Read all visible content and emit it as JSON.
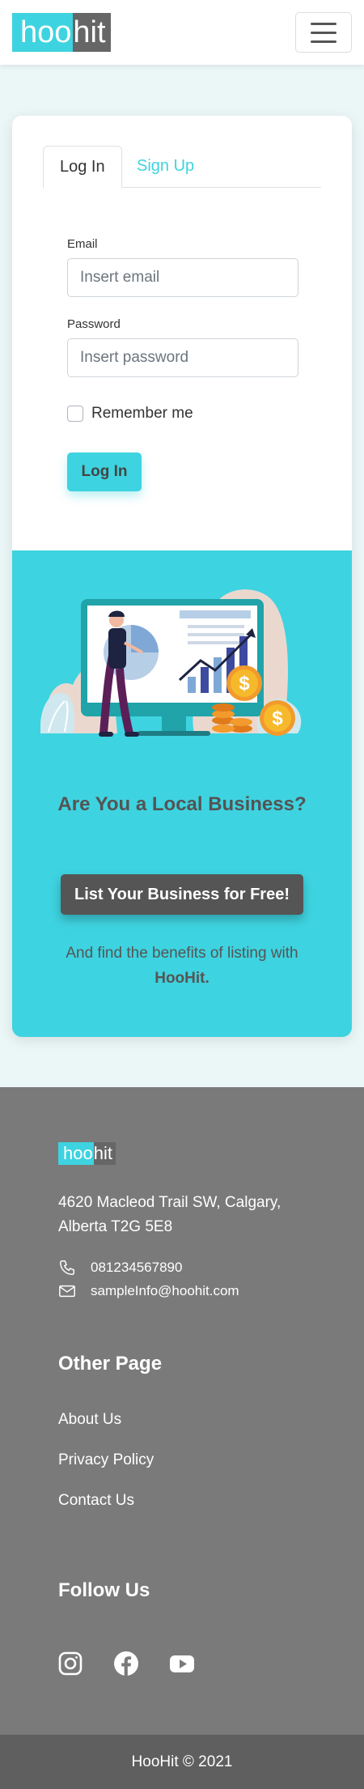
{
  "brand": {
    "part1": "hoo",
    "part2": "hit"
  },
  "tabs": {
    "login": "Log In",
    "signup": "Sign Up"
  },
  "form": {
    "email_label": "Email",
    "email_placeholder": "Insert email",
    "password_label": "Password",
    "password_placeholder": "Insert password",
    "remember_label": "Remember me",
    "submit_label": "Log In"
  },
  "promo": {
    "title": "Are You a Local Business?",
    "button": "List Your Business for Free!",
    "text": "And find the benefits of listing with",
    "text_bold": "HooHit."
  },
  "footer": {
    "address": "4620 Macleod Trail SW, Calgary, Alberta T2G 5E8",
    "phone": "081234567890",
    "email": "sampleInfo@hoohit.com",
    "other_heading": "Other Page",
    "links": [
      "About Us",
      "Privacy Policy",
      "Contact Us"
    ],
    "follow_heading": "Follow Us",
    "copyright": "HooHit © 2021"
  },
  "colors": {
    "accent": "#3ed3e0",
    "dark": "#555555",
    "footer": "#7a7a7a"
  },
  "icons": [
    "menu-icon",
    "phone-icon",
    "mail-icon",
    "instagram-icon",
    "facebook-icon",
    "youtube-icon"
  ]
}
